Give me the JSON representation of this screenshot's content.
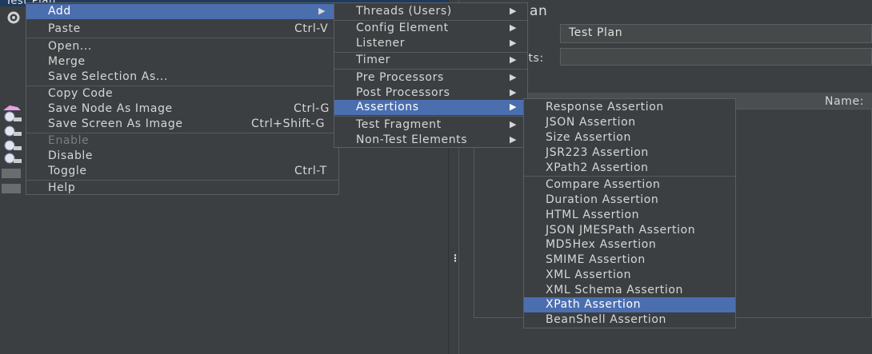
{
  "tree": {
    "title": "Test Plan"
  },
  "plan": {
    "title": "an",
    "name_value": "Test Plan",
    "comments_label": "nts:",
    "table_name_header": "Name:"
  },
  "splitter_glyph": "⋮",
  "context_menu": {
    "items": [
      {
        "label": "Add",
        "accel": "",
        "submenu": true
      },
      {
        "label": "Paste",
        "accel": "Ctrl-V"
      },
      {
        "label": "Open...",
        "accel": ""
      },
      {
        "label": "Merge",
        "accel": ""
      },
      {
        "label": "Save Selection As...",
        "accel": ""
      },
      {
        "label": "Copy Code",
        "accel": ""
      },
      {
        "label": "Save Node As Image",
        "accel": "Ctrl-G"
      },
      {
        "label": "Save Screen As Image",
        "accel": "Ctrl+Shift-G"
      },
      {
        "label": "Enable",
        "accel": ""
      },
      {
        "label": "Disable",
        "accel": ""
      },
      {
        "label": "Toggle",
        "accel": "Ctrl-T"
      },
      {
        "label": "Help",
        "accel": ""
      }
    ]
  },
  "add_menu": {
    "items": [
      {
        "label": "Threads (Users)"
      },
      {
        "label": "Config Element"
      },
      {
        "label": "Listener"
      },
      {
        "label": "Timer"
      },
      {
        "label": "Pre Processors"
      },
      {
        "label": "Post Processors"
      },
      {
        "label": "Assertions"
      },
      {
        "label": "Test Fragment"
      },
      {
        "label": "Non-Test Elements"
      }
    ]
  },
  "assertions_menu": {
    "items": [
      {
        "label": "Response Assertion"
      },
      {
        "label": "JSON Assertion"
      },
      {
        "label": "Size Assertion"
      },
      {
        "label": "JSR223 Assertion"
      },
      {
        "label": "XPath2 Assertion"
      },
      {
        "label": "Compare Assertion"
      },
      {
        "label": "Duration Assertion"
      },
      {
        "label": "HTML Assertion"
      },
      {
        "label": "JSON JMESPath Assertion"
      },
      {
        "label": "MD5Hex Assertion"
      },
      {
        "label": "SMIME Assertion"
      },
      {
        "label": "XML Assertion"
      },
      {
        "label": "XML Schema Assertion"
      },
      {
        "label": "XPath Assertion"
      },
      {
        "label": "BeanShell Assertion"
      }
    ]
  },
  "submenu_arrow": "▶",
  "colors": {
    "selection": "#4b6eaf",
    "menu_bg": "#3c3f41",
    "app_bg": "#3b3f42"
  }
}
